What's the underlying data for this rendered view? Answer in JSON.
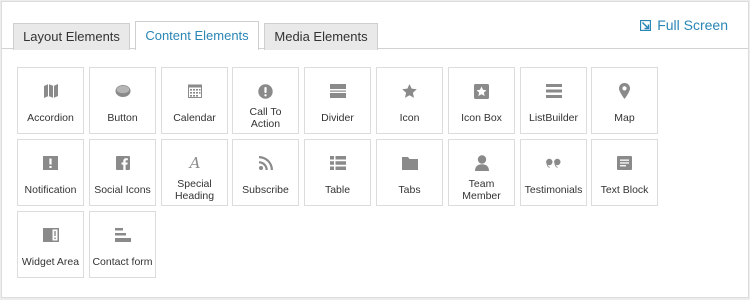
{
  "tabs": [
    {
      "label": "Layout Elements",
      "active": false
    },
    {
      "label": "Content Elements",
      "active": true
    },
    {
      "label": "Media Elements",
      "active": false
    }
  ],
  "fullscreen": {
    "label": "Full Screen",
    "icon": "expand-icon"
  },
  "elements": [
    {
      "label": "Accordion",
      "icon": "map-folded-icon"
    },
    {
      "label": "Button",
      "icon": "button-pill-icon"
    },
    {
      "label": "Calendar",
      "icon": "calendar-icon"
    },
    {
      "label": "Call To Action",
      "icon": "exclamation-circle-icon"
    },
    {
      "label": "Divider",
      "icon": "divider-icon"
    },
    {
      "label": "Icon",
      "icon": "star-icon"
    },
    {
      "label": "Icon Box",
      "icon": "star-box-icon"
    },
    {
      "label": "ListBuilder",
      "icon": "list-lines-icon"
    },
    {
      "label": "Map",
      "icon": "map-pin-icon"
    },
    {
      "label": "Notification",
      "icon": "exclamation-square-icon"
    },
    {
      "label": "Social Icons",
      "icon": "facebook-icon"
    },
    {
      "label": "Special Heading",
      "icon": "script-letter-icon"
    },
    {
      "label": "Subscribe",
      "icon": "rss-icon"
    },
    {
      "label": "Table",
      "icon": "table-list-icon"
    },
    {
      "label": "Tabs",
      "icon": "folder-icon"
    },
    {
      "label": "Team Member",
      "icon": "user-icon"
    },
    {
      "label": "Testimonials",
      "icon": "quote-icon"
    },
    {
      "label": "Text Block",
      "icon": "text-block-icon"
    },
    {
      "label": "Widget Area",
      "icon": "widget-area-icon"
    },
    {
      "label": "Contact form",
      "icon": "form-lines-icon"
    }
  ],
  "colors": {
    "accent": "#2a86b5",
    "icon": "#8a8a8a",
    "text": "#333333",
    "border": "#dcdcdc"
  }
}
